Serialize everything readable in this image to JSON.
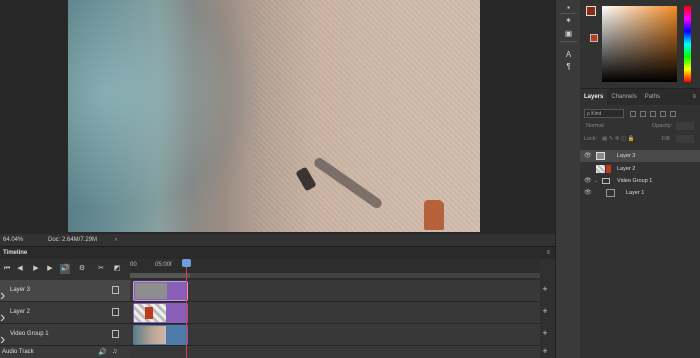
{
  "status": {
    "zoom": "64.04%",
    "doc": "Doc: 2.64M/7.29M",
    "arrow": "›"
  },
  "layers": {
    "tabs": [
      "Layers",
      "Channels",
      "Paths"
    ],
    "kind": "ρ Kind",
    "blend": "Normal",
    "opacity_label": "Opacity:",
    "lock_label": "Lock:",
    "fill_label": "Fill:",
    "items": [
      {
        "name": "Layer 3",
        "selected": true
      },
      {
        "name": "Layer 2",
        "selected": false
      },
      {
        "name": "Video Group 1",
        "selected": false
      },
      {
        "name": "Layer 1",
        "selected": false
      }
    ]
  },
  "timeline": {
    "title": "Timeline",
    "time_start": "00",
    "time_mark": "05:00f",
    "tracks": [
      {
        "name": "Layer 3"
      },
      {
        "name": "Layer 2"
      },
      {
        "name": "Video Group 1"
      },
      {
        "name": "Audio Track"
      }
    ]
  },
  "colors": {
    "foreground": "#8c2a12",
    "background": "#c0391a",
    "clip_purple": "#8a5fb8",
    "clip_blue": "#4d7aa8"
  }
}
